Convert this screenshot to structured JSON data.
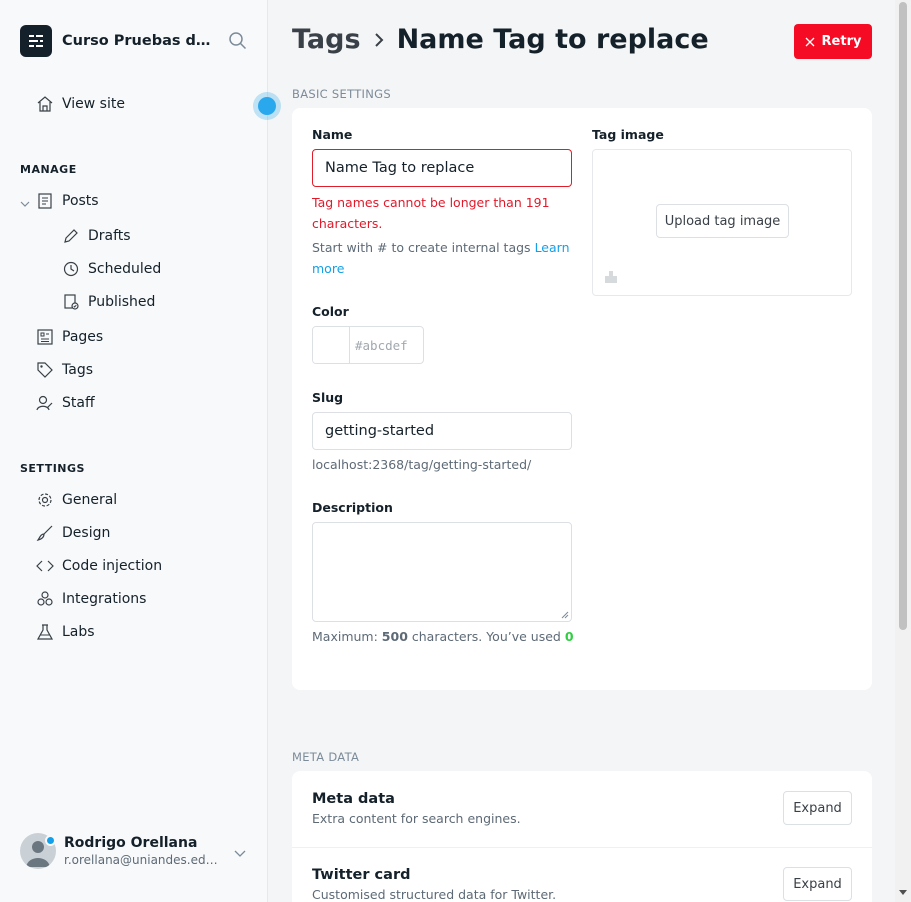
{
  "sidebar": {
    "site_title": "Curso Pruebas de Automatización",
    "view_site": "View site",
    "manage_heading": "MANAGE",
    "posts": "Posts",
    "drafts": "Drafts",
    "scheduled": "Scheduled",
    "published": "Published",
    "pages": "Pages",
    "tags": "Tags",
    "staff": "Staff",
    "settings_heading": "SETTINGS",
    "general": "General",
    "design": "Design",
    "code_injection": "Code injection",
    "integrations": "Integrations",
    "labs": "Labs",
    "user_name": "Rodrigo Orellana",
    "user_email": "r.orellana@uniandes.edu.co"
  },
  "header": {
    "breadcrumb_parent": "Tags",
    "title": "Name Tag to replace",
    "retry_label": "Retry"
  },
  "basic": {
    "section_label": "BASIC SETTINGS",
    "name_label": "Name",
    "name_value": "Name Tag to replace",
    "name_error": "Tag names cannot be longer than 191 characters.",
    "name_help": "Start with # to create internal tags",
    "learn_more": "Learn more",
    "color_label": "Color",
    "color_placeholder": "#abcdef",
    "slug_label": "Slug",
    "slug_value": "getting-started",
    "slug_url": "localhost:2368/tag/getting-started/",
    "description_label": "Description",
    "desc_help_prefix": "Maximum:",
    "desc_max": "500",
    "desc_help_mid": "characters. You’ve used",
    "desc_used": "0",
    "tag_image_label": "Tag image",
    "upload_label": "Upload tag image"
  },
  "meta": {
    "section_label": "META DATA",
    "meta_title": "Meta data",
    "meta_sub": "Extra content for search engines.",
    "twitter_title": "Twitter card",
    "twitter_sub": "Customised structured data for Twitter.",
    "expand_label": "Expand"
  },
  "colors": {
    "accent": "#14a0e8",
    "danger": "#f50b23",
    "success": "#30cf43"
  }
}
